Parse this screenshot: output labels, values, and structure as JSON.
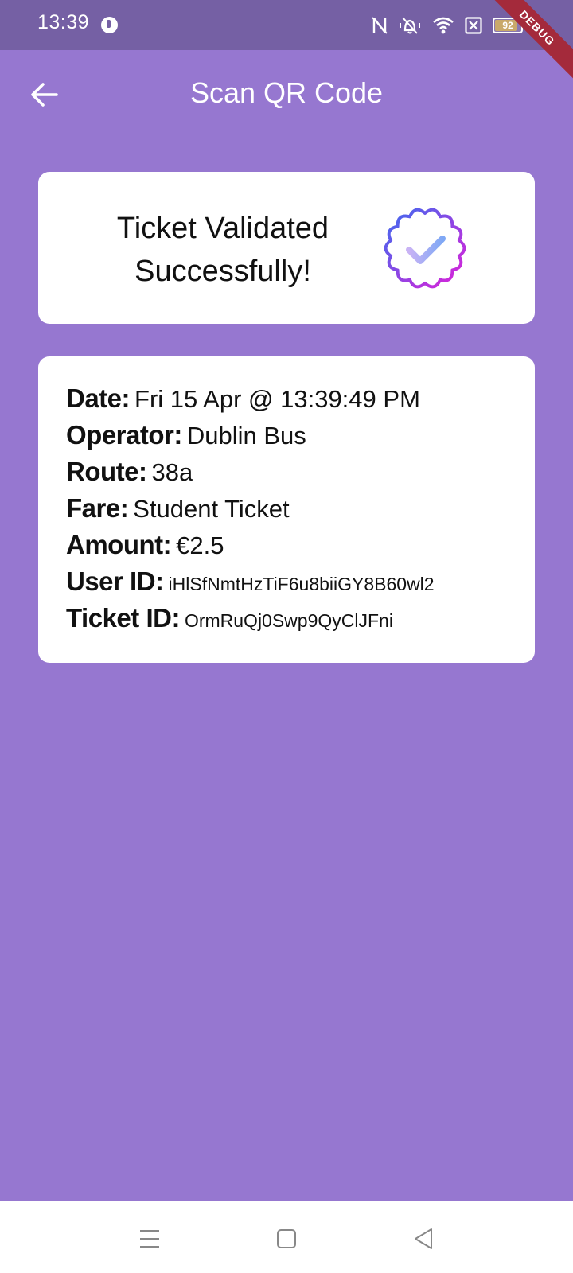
{
  "status_bar": {
    "time": "13:39",
    "battery": "92"
  },
  "debug_banner": "DEBUG",
  "app_bar": {
    "title": "Scan QR Code"
  },
  "validation": {
    "message": "Ticket Validated Successfully!"
  },
  "ticket": {
    "rows": [
      {
        "label": "Date:",
        "value": "Fri 15 Apr @ 13:39:49 PM"
      },
      {
        "label": "Operator:",
        "value": "Dublin Bus"
      },
      {
        "label": "Route:",
        "value": "38a"
      },
      {
        "label": "Fare:",
        "value": "Student Ticket"
      },
      {
        "label": "Amount:",
        "value": "€2.5"
      },
      {
        "label": "User ID:",
        "value": "iHlSfNmtHzTiF6u8biiGY8B60wl2"
      },
      {
        "label": "Ticket ID:",
        "value": "OrmRuQj0Swp9QyClJFni"
      }
    ]
  },
  "colors": {
    "background": "#9677d0",
    "status_bar": "#7560a4",
    "card": "#ffffff",
    "badge_gradient_start": "#3b6cf0",
    "badge_gradient_end": "#e020d8"
  }
}
